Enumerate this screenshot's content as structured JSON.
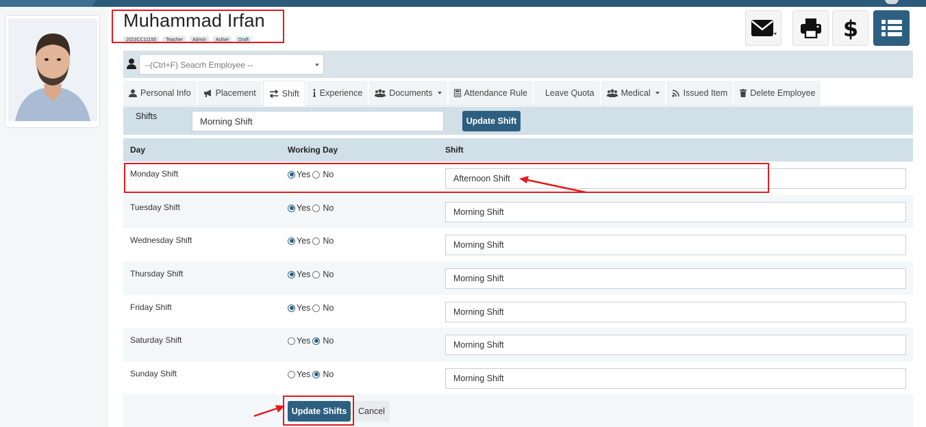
{
  "employee": {
    "name": "Muhammad Irfan",
    "badges": [
      "2023CC11155",
      "Teacher",
      "Admin",
      "Active",
      "Draft"
    ]
  },
  "header_actions": [
    "envelope-icon",
    "printer-icon",
    "dollar-icon",
    "list-icon"
  ],
  "search": {
    "placeholder": "--(Ctrl+F) Seacrh Employee --"
  },
  "tabs": [
    {
      "label": "Personal Info",
      "icon": "user-icon"
    },
    {
      "label": "Placement",
      "icon": "bullhorn-icon"
    },
    {
      "label": "Shift",
      "icon": "exchange-icon",
      "active": true
    },
    {
      "label": "Experience",
      "icon": "info-icon"
    },
    {
      "label": "Documents",
      "icon": "users-icon",
      "dropdown": true
    },
    {
      "label": "Attendance Rule",
      "icon": "calculator-icon"
    },
    {
      "label": "Leave Quota",
      "icon": ""
    },
    {
      "label": "Medical",
      "icon": "users-icon",
      "dropdown": true
    },
    {
      "label": "Issued Item",
      "icon": "wifi-icon"
    },
    {
      "label": "Delete Employee",
      "icon": "trash-icon"
    }
  ],
  "shift_bar": {
    "label": "Shifts",
    "value": "Morning Shift",
    "button": "Update Shift"
  },
  "table": {
    "headers": [
      "Day",
      "Working Day",
      "Shift"
    ],
    "yes_label": "Yes",
    "no_label": "No",
    "rows": [
      {
        "day": "Monday Shift",
        "working": "yes",
        "shift": "Afternoon Shift"
      },
      {
        "day": "Tuesday Shift",
        "working": "yes",
        "shift": "Morning Shift"
      },
      {
        "day": "Wednesday Shift",
        "working": "yes",
        "shift": "Morning Shift"
      },
      {
        "day": "Thursday Shift",
        "working": "yes",
        "shift": "Morning Shift"
      },
      {
        "day": "Friday Shift",
        "working": "yes",
        "shift": "Morning Shift"
      },
      {
        "day": "Saturday Shift",
        "working": "no",
        "shift": "Morning Shift"
      },
      {
        "day": "Sunday Shift",
        "working": "no",
        "shift": "Morning Shift"
      }
    ]
  },
  "footer": {
    "update_button": "Update Shifts",
    "cancel_button": "Cancel"
  },
  "colors": {
    "primary": "#2d5f80",
    "highlight": "#e5191c",
    "header_bg": "#d1dfe8"
  }
}
